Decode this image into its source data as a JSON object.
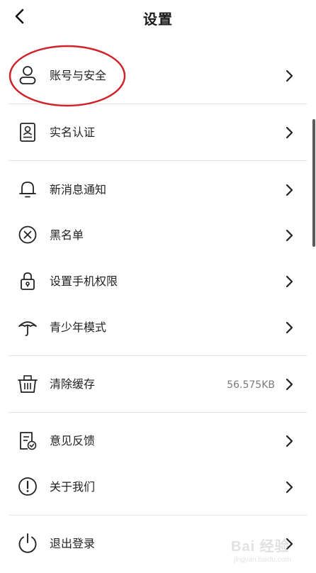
{
  "header": {
    "title": "设置"
  },
  "items": [
    {
      "label": "账号与安全"
    },
    {
      "label": "实名认证"
    },
    {
      "label": "新消息通知"
    },
    {
      "label": "黑名单"
    },
    {
      "label": "设置手机权限"
    },
    {
      "label": "青少年模式"
    },
    {
      "label": "清除缓存",
      "value": "56.575KB"
    },
    {
      "label": "意见反馈"
    },
    {
      "label": "关于我们"
    },
    {
      "label": "退出登录"
    }
  ],
  "icons": {
    "back": "chevron-left-icon",
    "chevron": "chevron-right-icon"
  },
  "colors": {
    "annotation": "#d0222a",
    "text": "#222222",
    "secondary_text": "#7a7a7a",
    "divider": "#e6e6e6"
  },
  "watermark": {
    "text": "Bai 经验",
    "sub": "jingyan.baidu.com"
  }
}
